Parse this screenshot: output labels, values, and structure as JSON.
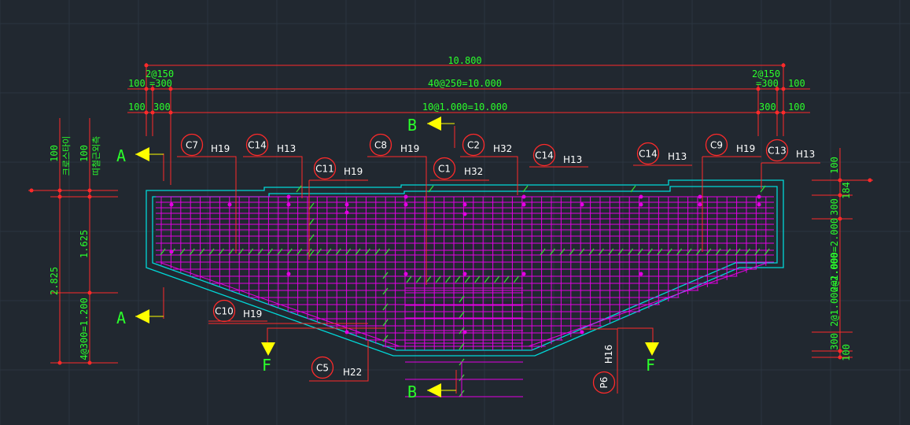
{
  "colors": {
    "background": "#212830",
    "grid": "#2c3540",
    "dimension_line": "#ff2a2a",
    "dimension_text": "#2bff2b",
    "rebar": "#e400e4",
    "outline": "#00d8d8",
    "stirrup": "#36d636",
    "label_text": "#ffffff",
    "marker_fill": "#ffff00",
    "section_text": "#2bff2b"
  },
  "dimensions": {
    "overall": "10.800",
    "top_left_a": "2@150",
    "top_left_b": "100",
    "top_left_c": "=300",
    "top_mid": "40@250=10.000",
    "top_right_a": "2@150",
    "top_right_b": "=300",
    "top_right_c": "100",
    "row3_left_a": "100",
    "row3_left_b": "300",
    "row3_mid": "10@1.000=10.000",
    "row3_right_a": "300",
    "row3_right_b": "100",
    "left_total": "2.825",
    "left_upper": "1.625",
    "left_lower": "4@300=1.200",
    "left_top_100a": "100",
    "left_top_100b": "100",
    "left_note_a": "크로스타이",
    "left_note_b": "띠철근외측",
    "right_100": "100",
    "right_184": "184",
    "right_300a": "300",
    "right_mid": "2@1.000=2.000",
    "right_lower": "2@1.000=2.000",
    "right_300b": "300",
    "right_100b": "100"
  },
  "sections": {
    "a_top": "A",
    "a_bottom": "A",
    "b_top": "B",
    "b_bottom": "B",
    "f_left": "F",
    "f_right": "F"
  },
  "rebar_tags": {
    "c7": {
      "id": "C7",
      "size": "H19"
    },
    "c14a": {
      "id": "C14",
      "size": "H13"
    },
    "c11": {
      "id": "C11",
      "size": "H19"
    },
    "c8": {
      "id": "C8",
      "size": "H19"
    },
    "c1": {
      "id": "C1",
      "size": "H32"
    },
    "c2": {
      "id": "C2",
      "size": "H32"
    },
    "c14b": {
      "id": "C14",
      "size": "H13"
    },
    "c14c": {
      "id": "C14",
      "size": "H13"
    },
    "c9": {
      "id": "C9",
      "size": "H19"
    },
    "c13": {
      "id": "C13",
      "size": "H13"
    },
    "c10": {
      "id": "C10",
      "size": "H19"
    },
    "c5": {
      "id": "C5",
      "size": "H22"
    },
    "p6": {
      "id": "P6",
      "size": "H16"
    }
  }
}
